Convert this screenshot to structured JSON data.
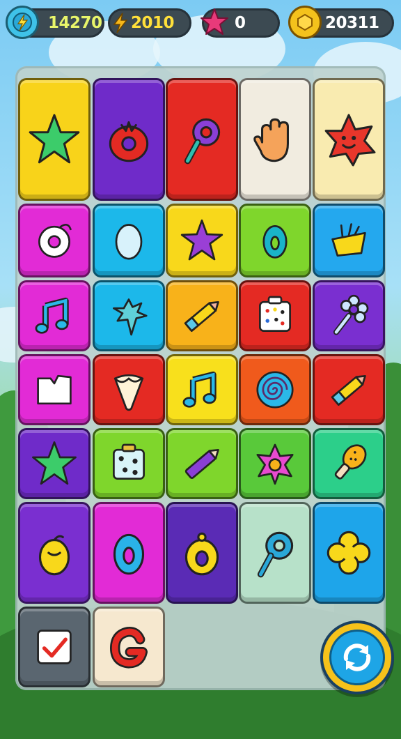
{
  "hud": {
    "energy": {
      "icon": "lightning-icon",
      "value": "14270"
    },
    "power": {
      "icon": "lightning-bolt-icon",
      "value": "2010"
    },
    "stars": {
      "icon": "pink-star-icon",
      "value": "0"
    },
    "coins": {
      "icon": "gold-coin-icon",
      "value": "20311"
    }
  },
  "board": {
    "tiles": [
      {
        "row": 0,
        "col": 0,
        "color": "#f8d31a",
        "icon": "star-icon",
        "tall": true
      },
      {
        "row": 0,
        "col": 1,
        "color": "#6f2bc9",
        "icon": "tomato-icon",
        "tall": true
      },
      {
        "row": 0,
        "col": 2,
        "color": "#e42a23",
        "icon": "purple-gear-wand-icon",
        "tall": true
      },
      {
        "row": 0,
        "col": 3,
        "color": "#f1ece0",
        "icon": "hand-icon",
        "tall": true
      },
      {
        "row": 0,
        "col": 4,
        "color": "#f9ebb0",
        "icon": "smiling-star-icon",
        "tall": true
      },
      {
        "row": 1,
        "col": 0,
        "color": "#e22bd6",
        "icon": "donut-ring-icon"
      },
      {
        "row": 1,
        "col": 1,
        "color": "#1cb8ea",
        "icon": "egg-icon"
      },
      {
        "row": 1,
        "col": 2,
        "color": "#f8d81b",
        "icon": "purple-star-icon"
      },
      {
        "row": 1,
        "col": 3,
        "color": "#7fd62c",
        "icon": "teal-ring-icon"
      },
      {
        "row": 1,
        "col": 4,
        "color": "#24a8ee",
        "icon": "basket-icon"
      },
      {
        "row": 2,
        "col": 0,
        "color": "#e22bd6",
        "icon": "music-note-icon"
      },
      {
        "row": 2,
        "col": 1,
        "color": "#1cb8ea",
        "icon": "splash-icon"
      },
      {
        "row": 2,
        "col": 2,
        "color": "#f8b21a",
        "icon": "crayon-icon"
      },
      {
        "row": 2,
        "col": 3,
        "color": "#e42a23",
        "icon": "dice-icon"
      },
      {
        "row": 2,
        "col": 4,
        "color": "#7a2fd0",
        "icon": "flower-wand-icon"
      },
      {
        "row": 3,
        "col": 0,
        "color": "#e22bd6",
        "icon": "paper-icon"
      },
      {
        "row": 3,
        "col": 1,
        "color": "#e42a23",
        "icon": "tooth-icon"
      },
      {
        "row": 3,
        "col": 2,
        "color": "#f8e01c",
        "icon": "music-note-icon"
      },
      {
        "row": 3,
        "col": 3,
        "color": "#f05a1c",
        "icon": "spiral-icon"
      },
      {
        "row": 3,
        "col": 4,
        "color": "#e42a23",
        "icon": "crayon-icon"
      },
      {
        "row": 4,
        "col": 0,
        "color": "#6f2bc9",
        "icon": "star-icon"
      },
      {
        "row": 4,
        "col": 1,
        "color": "#7fd62c",
        "icon": "dice-box-icon"
      },
      {
        "row": 4,
        "col": 2,
        "color": "#7fd62c",
        "icon": "purple-crayon-icon"
      },
      {
        "row": 4,
        "col": 3,
        "color": "#59c93a",
        "icon": "pink-flower-icon"
      },
      {
        "row": 4,
        "col": 4,
        "color": "#2ccf8a",
        "icon": "drumstick-icon"
      },
      {
        "row": 5,
        "col": 0,
        "color": "#7a2fd0",
        "icon": "lemon-icon",
        "tall": true
      },
      {
        "row": 5,
        "col": 1,
        "color": "#e22bd6",
        "icon": "blue-ring-icon",
        "tall": true
      },
      {
        "row": 5,
        "col": 2,
        "color": "#5a2bb5",
        "icon": "yellow-ring-icon",
        "tall": true
      },
      {
        "row": 5,
        "col": 3,
        "color": "#b7e1c9",
        "icon": "gear-wand-icon",
        "tall": true
      },
      {
        "row": 5,
        "col": 4,
        "color": "#1ea5ea",
        "icon": "yellow-flower-icon",
        "tall": true
      },
      {
        "row": 6,
        "col": 0,
        "color": "#5a6670",
        "icon": "checkbox-icon"
      },
      {
        "row": 6,
        "col": 1,
        "color": "#f6e8cf",
        "icon": "letter-g-icon"
      }
    ]
  },
  "refresh": {
    "icon": "refresh-icon"
  },
  "colors": {
    "hud_bg": "#3c4a52",
    "hud_text": "#fff06a",
    "coin_text": "#ffffff",
    "star_text": "#ffffff"
  }
}
